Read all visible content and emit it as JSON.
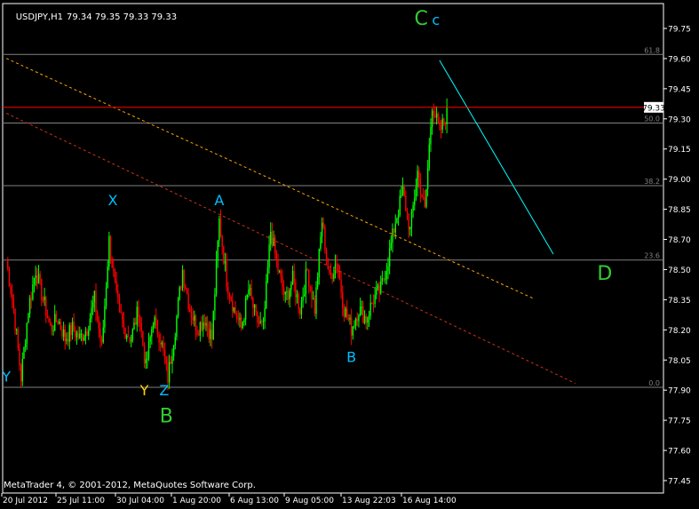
{
  "header": {
    "symbol": "USDJPY,H1",
    "ohlc": "79.34 79.35 79.33 79.33"
  },
  "footer": {
    "copyright": "MetaTrader 4, © 2001-2012, MetaQuotes Software Corp."
  },
  "colors": {
    "background": "#000000",
    "grid": "#ffffff",
    "bull_candle": "#00ff00",
    "bear_candle": "#ff0000",
    "bid_line": "#ff0000",
    "fib_lines": "#808080",
    "trend_orange": "#ffa500",
    "trend_red": "#c83214",
    "projection": "#00ffff",
    "wave_blue": "#00bfff",
    "wave_green": "#32cd32",
    "wave_yellow": "#ffd700"
  },
  "chart_data": {
    "type": "candlestick",
    "ylim": [
      77.36,
      79.86
    ],
    "yticks": [
      "79.75",
      "79.60",
      "79.45",
      "79.30",
      "79.15",
      "79.00",
      "78.85",
      "78.70",
      "78.50",
      "78.35",
      "78.20",
      "78.05",
      "77.90",
      "77.75",
      "77.60",
      "77.45"
    ],
    "xticks": [
      "20 Jul 2012",
      "25 Jul 11:00",
      "30 Jul 04:00",
      "1 Aug 20:00",
      "6 Aug 13:00",
      "9 Aug 05:00",
      "13 Aug 22:03",
      "16 Aug 14:00"
    ],
    "current_price": "79.33",
    "price_path": [
      78.55,
      78.3,
      77.95,
      78.3,
      78.5,
      78.35,
      78.2,
      78.25,
      78.15,
      78.2,
      78.15,
      78.2,
      78.35,
      78.1,
      78.65,
      78.35,
      78.2,
      78.15,
      78.3,
      78.0,
      78.25,
      78.15,
      77.95,
      78.2,
      78.5,
      78.3,
      78.2,
      78.25,
      78.15,
      78.75,
      78.45,
      78.3,
      78.2,
      78.4,
      78.25,
      78.2,
      78.7,
      78.5,
      78.35,
      78.45,
      78.3,
      78.5,
      78.3,
      78.75,
      78.45,
      78.55,
      78.3,
      78.2,
      78.3,
      78.25,
      78.35,
      78.4,
      78.55,
      78.75,
      78.9,
      78.7,
      79.0,
      78.8,
      79.35,
      79.2,
      79.3
    ],
    "fibonacci": [
      {
        "label": "61.8",
        "price": 79.6
      },
      {
        "label": "50.0",
        "price": 79.25
      },
      {
        "label": "38.2",
        "price": 78.93
      },
      {
        "label": "23.6",
        "price": 78.55
      },
      {
        "label": "0.0",
        "price": 77.9
      }
    ],
    "wave_labels": [
      {
        "text": "C",
        "color": "green",
        "size": "large",
        "bar": 56.5,
        "price": 79.75
      },
      {
        "text": "c",
        "color": "blue",
        "size": "small",
        "bar": 58.5,
        "price": 79.75
      },
      {
        "text": "X",
        "color": "blue",
        "size": "small",
        "bar": 14.5,
        "price": 78.83
      },
      {
        "text": "A",
        "color": "blue",
        "size": "small",
        "bar": 29,
        "price": 78.83
      },
      {
        "text": "B",
        "color": "blue",
        "size": "small",
        "bar": 47,
        "price": 78.03
      },
      {
        "text": "Y",
        "color": "blue",
        "size": "small",
        "bar": 0,
        "price": 77.93
      },
      {
        "text": "Y",
        "color": "yellow",
        "size": "small",
        "bar": 18.8,
        "price": 77.86
      },
      {
        "text": "Z",
        "color": "blue",
        "size": "small",
        "bar": 21.5,
        "price": 77.86
      },
      {
        "text": "B",
        "color": "green",
        "size": "large",
        "bar": 21.8,
        "price": 77.72
      },
      {
        "text": "D",
        "color": "green",
        "size": "large",
        "bar": 81.5,
        "price": 78.45
      }
    ],
    "trendlines": [
      {
        "name": "channel-upper",
        "from": [
          0,
          79.58
        ],
        "to": [
          72,
          78.35
        ],
        "color": "orange",
        "dashed": true
      },
      {
        "name": "channel-lower",
        "from": [
          0,
          79.3
        ],
        "to": [
          77.5,
          77.92
        ],
        "color": "red",
        "dashed": true
      },
      {
        "name": "projection",
        "from": [
          59,
          79.57
        ],
        "to": [
          74.5,
          78.58
        ],
        "color": "cyan",
        "dashed": false
      }
    ]
  }
}
